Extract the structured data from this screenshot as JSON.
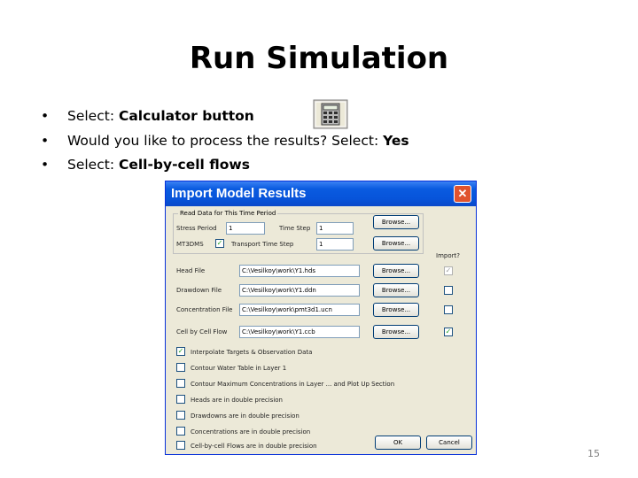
{
  "slide": {
    "title": "Run Simulation",
    "page_number": "15",
    "bullets": [
      {
        "prefix": "Select:  ",
        "bold": "Calculator button",
        "suffix": ""
      },
      {
        "prefix": "Would you like to process the results? Select: ",
        "bold": "Yes",
        "suffix": ""
      },
      {
        "prefix": "Select: ",
        "bold": "Cell-by-cell flows",
        "suffix": ""
      }
    ],
    "bullet_char": "•",
    "calculator_icon": "calculator-icon"
  },
  "dialog": {
    "title": "Import Model Results",
    "close_glyph": "✕",
    "group_label": "Read Data for This Time Period",
    "stress_period_label": "Stress Period",
    "stress_period_value": "1",
    "time_step_label": "Time Step",
    "time_step_value": "1",
    "mt3d_label": "MT3DMS",
    "mt3d_checked": "✓",
    "transport_step_label": "Transport Time Step",
    "transport_step_value": "1",
    "browse_label": "Browse...",
    "import_label": "Import?",
    "files": [
      {
        "label": "Head File",
        "path": "C:\\Vesilkoy\\work\\Y1.hds",
        "checked": "✓"
      },
      {
        "label": "Drawdown File",
        "path": "C:\\Vesilkoy\\work\\Y1.ddn",
        "checked": ""
      },
      {
        "label": "Concentration File",
        "path": "C:\\Vesilkoy\\work\\pmt3d1.ucn",
        "checked": ""
      },
      {
        "label": "Cell by Cell Flow",
        "path": "C:\\Vesilkoy\\work\\Y1.ccb",
        "checked": "✓"
      }
    ],
    "options": [
      {
        "label": "Interpolate Targets & Observation Data",
        "checked": "✓"
      },
      {
        "label": "Contour Water Table in Layer 1",
        "checked": ""
      },
      {
        "label": "Contour Maximum Concentrations in Layer ... and Plot Up Section",
        "checked": ""
      },
      {
        "label": "Heads are in double precision",
        "checked": ""
      },
      {
        "label": "Drawdowns are in double precision",
        "checked": ""
      },
      {
        "label": "Concentrations are in double precision",
        "checked": ""
      },
      {
        "label": "Cell-by-cell Flows are in double precision",
        "checked": ""
      }
    ],
    "ok_label": "OK",
    "cancel_label": "Cancel"
  }
}
